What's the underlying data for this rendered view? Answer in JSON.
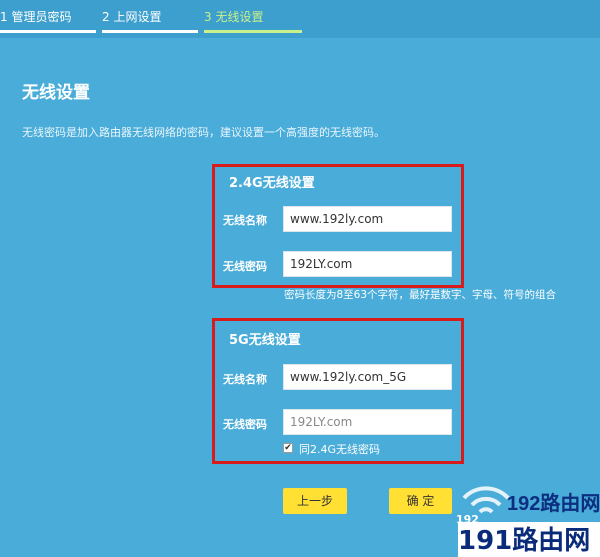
{
  "steps": [
    {
      "label": "1 管理员密码"
    },
    {
      "label": "2 上网设置"
    },
    {
      "label": "3 无线设置"
    }
  ],
  "page": {
    "title": "无线设置",
    "description": "无线密码是加入路由器无线网络的密码，建议设置一个高强度的无线密码。"
  },
  "band24": {
    "title": "2.4G无线设置",
    "name_label": "无线名称",
    "name_value": "www.192ly.com",
    "password_label": "无线密码",
    "password_value": "192LY.com",
    "hint": "密码长度为8至63个字符，最好是数字、字母、符号的组合"
  },
  "band5": {
    "title": "5G无线设置",
    "name_label": "无线名称",
    "name_value": "www.192ly.com_5G",
    "password_label": "无线密码",
    "password_placeholder": "192LY.com",
    "same_password_label": "同2.4G无线密码",
    "same_password_checked": "✔"
  },
  "buttons": {
    "prev": "上一步",
    "confirm": "确 定"
  },
  "watermark": {
    "top": "192路由网",
    "small": "192",
    "big": "191路由网"
  },
  "colors": {
    "background": "#49acd9",
    "highlight_box": "#d81b1b",
    "button": "#ffe033",
    "active_step": "#c9f08a"
  }
}
